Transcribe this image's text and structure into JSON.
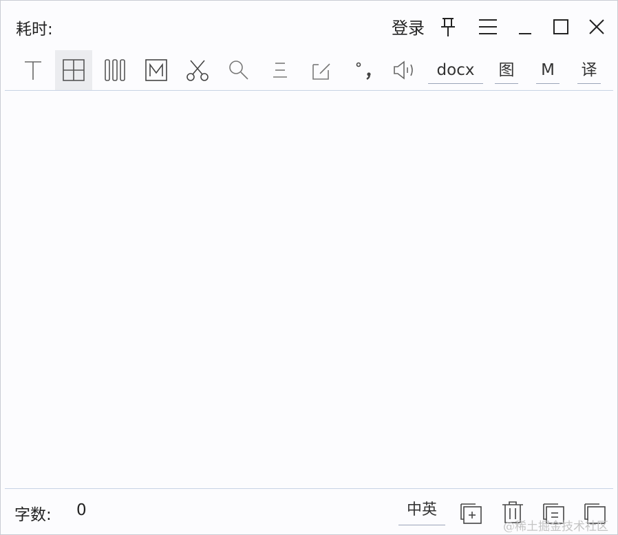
{
  "title_bar": {
    "time_label": "耗时:",
    "login_label": "登录"
  },
  "toolbar": {
    "text_buttons": {
      "docx": "docx",
      "image": "图",
      "markdown": "M",
      "translate": "译"
    }
  },
  "footer": {
    "word_count_label": "字数:",
    "word_count_value": "0",
    "language_label": "中英"
  },
  "watermark": "@稀土掘金技术社区",
  "colors": {
    "window_bg": "#fcfcfe",
    "divider": "#c7d2e4",
    "active_tool_bg": "#ebecef"
  }
}
